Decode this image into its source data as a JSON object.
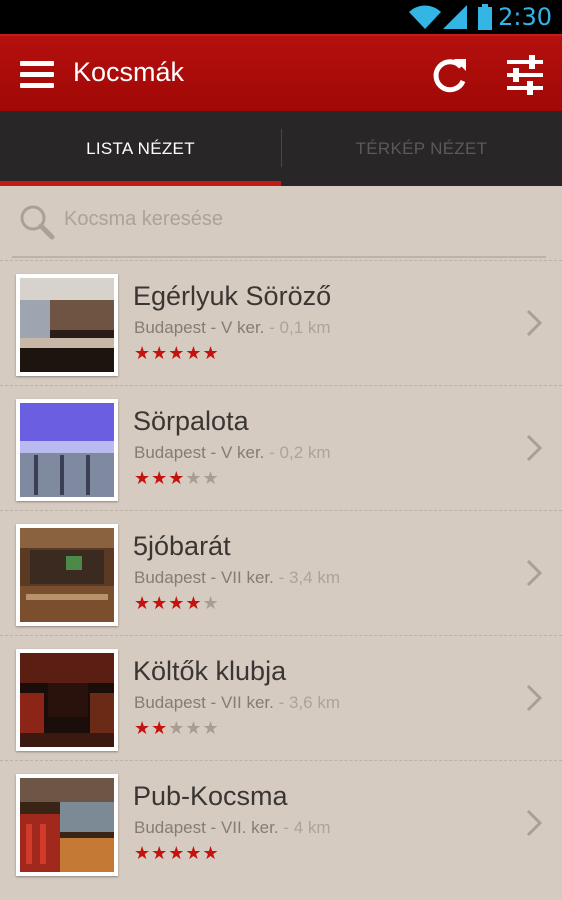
{
  "status": {
    "time": "2:30"
  },
  "app": {
    "title": "Kocsmák"
  },
  "tabs": [
    {
      "label": "LISTA NÉZET",
      "active": true
    },
    {
      "label": "TÉRKÉP NÉZET",
      "active": false
    }
  ],
  "search": {
    "placeholder": "Kocsma keresése"
  },
  "pubs": [
    {
      "name": "Egérlyuk Söröző",
      "location": "Budapest - V ker.",
      "distance": "- 0,1 km",
      "rating": 5
    },
    {
      "name": "Sörpalota",
      "location": "Budapest - V ker.",
      "distance": "- 0,2 km",
      "rating": 3
    },
    {
      "name": "5jóbarát",
      "location": "Budapest - VII ker.",
      "distance": "- 3,4 km",
      "rating": 4
    },
    {
      "name": "Költők klubja",
      "location": "Budapest - VII ker.",
      "distance": "- 3,6 km",
      "rating": 2
    },
    {
      "name": "Pub-Kocsma",
      "location": "Budapest - VII. ker.",
      "distance": "- 4 km",
      "rating": 5
    }
  ],
  "colors": {
    "accent": "#b4100e",
    "star_on": "#c4130f",
    "star_off": "#a79d93"
  }
}
